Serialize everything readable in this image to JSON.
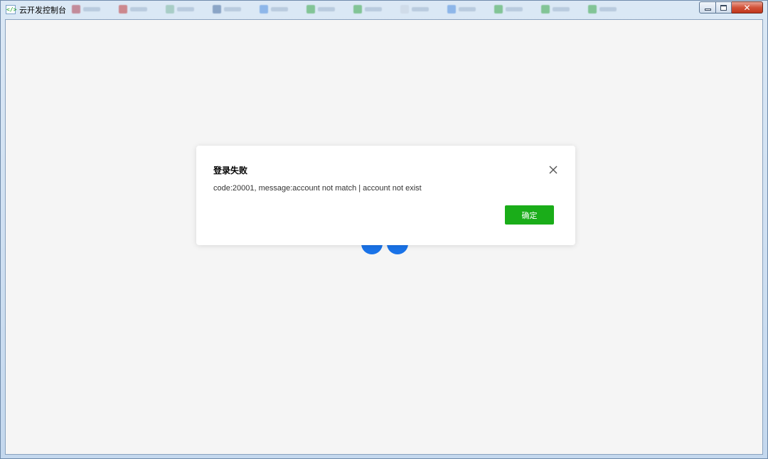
{
  "window": {
    "title": "云开发控制台",
    "icon": "code-brackets-icon",
    "icon_glyph": "</>",
    "close_glyph": "✕"
  },
  "dialog": {
    "title": "登录失败",
    "message": "code:20001, message:account not match | account not exist",
    "confirm_label": "确定",
    "close_icon": "close-icon"
  },
  "loading": {
    "indicator": "loading-dots",
    "color": "#1a73e8"
  },
  "colors": {
    "confirm_button": "#1aad19",
    "background": "#f5f5f5",
    "dialog": "#ffffff"
  }
}
